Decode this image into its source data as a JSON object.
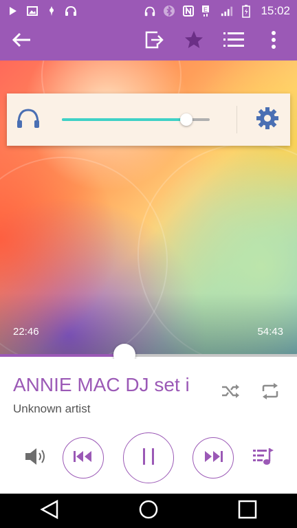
{
  "status_bar": {
    "time": "15:02",
    "icons_left": [
      "play-icon",
      "image-icon",
      "gesture-icon",
      "headset-app-icon"
    ],
    "icons_right": [
      "headphones-icon",
      "bluetooth-icon",
      "nfc-icon",
      "network-e-icon",
      "signal-icon",
      "battery-charging-icon"
    ]
  },
  "top_bar": {
    "back_icon": "arrow-left-icon",
    "actions": [
      "share-to-device-icon",
      "star-icon",
      "playlist-icon",
      "more-vert-icon"
    ],
    "color": "#9b59b6"
  },
  "volume_panel": {
    "headphones_icon": "headphones-icon",
    "settings_icon": "gear-icon",
    "level": 0.84,
    "fill_color": "#3fd1c6"
  },
  "playback": {
    "elapsed": "22:46",
    "total": "54:43",
    "progress": 0.42
  },
  "track": {
    "title": "ANNIE MAC DJ set i",
    "artist": "Unknown artist"
  },
  "controls": {
    "volume_icon": "speaker-icon",
    "prev_icon": "skip-previous-icon",
    "play_pause_icon": "pause-icon",
    "next_icon": "skip-next-icon",
    "queue_icon": "queue-music-icon",
    "shuffle_icon": "shuffle-icon",
    "repeat_icon": "repeat-icon",
    "accent": "#9b59b6"
  },
  "nav_bar": {
    "back": "nav-back-icon",
    "home": "nav-home-icon",
    "recents": "nav-recents-icon"
  }
}
